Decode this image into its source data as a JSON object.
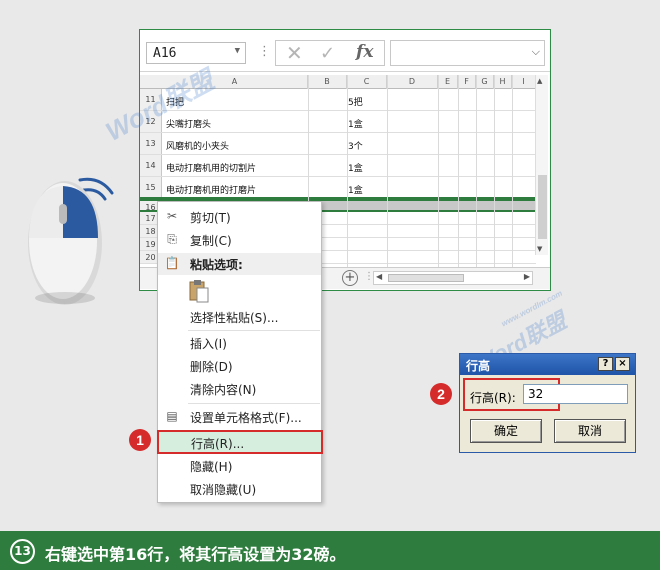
{
  "excel": {
    "namebox": "A16",
    "columns": [
      "A",
      "B",
      "C",
      "D",
      "E",
      "F",
      "G",
      "H",
      "I"
    ],
    "rows": [
      {
        "num": "11",
        "a": "扫把",
        "c": "5把"
      },
      {
        "num": "12",
        "a": "尖嘴打磨头",
        "c": "1盒"
      },
      {
        "num": "13",
        "a": "风磨机的小夹头",
        "c": "3个"
      },
      {
        "num": "14",
        "a": "电动打磨机用的切割片",
        "c": "1盒"
      },
      {
        "num": "15",
        "a": "电动打磨机用的打磨片",
        "c": "1盒"
      },
      {
        "num": "16",
        "a": "",
        "c": ""
      },
      {
        "num": "17",
        "a": "",
        "c": ""
      },
      {
        "num": "18",
        "a": "",
        "c": ""
      },
      {
        "num": "19",
        "a": "",
        "c": ""
      },
      {
        "num": "20",
        "a": "",
        "c": ""
      }
    ]
  },
  "context_menu": {
    "cut": "剪切(T)",
    "copy": "复制(C)",
    "paste_options": "粘贴选项:",
    "paste_special": "选择性粘贴(S)...",
    "insert": "插入(I)",
    "delete": "删除(D)",
    "clear": "清除内容(N)",
    "format_cells": "设置单元格格式(F)...",
    "row_height": "行高(R)...",
    "hide": "隐藏(H)",
    "unhide": "取消隐藏(U)"
  },
  "dialog": {
    "title": "行高",
    "help": "?",
    "close": "×",
    "label": "行高(R):",
    "value": "32",
    "ok": "确定",
    "cancel": "取消"
  },
  "badges": {
    "one": "1",
    "two": "2"
  },
  "watermark": {
    "word": "Word",
    "brand": "联盟",
    "url": "www.wordlm.com"
  },
  "footer": {
    "step": "13",
    "caption": "右键选中第16行，将其行高设置为32磅。"
  },
  "colors": {
    "accent_green": "#2f7d3e",
    "highlight_red": "#d62b2b",
    "mouse_blue": "#2c5aa0"
  }
}
